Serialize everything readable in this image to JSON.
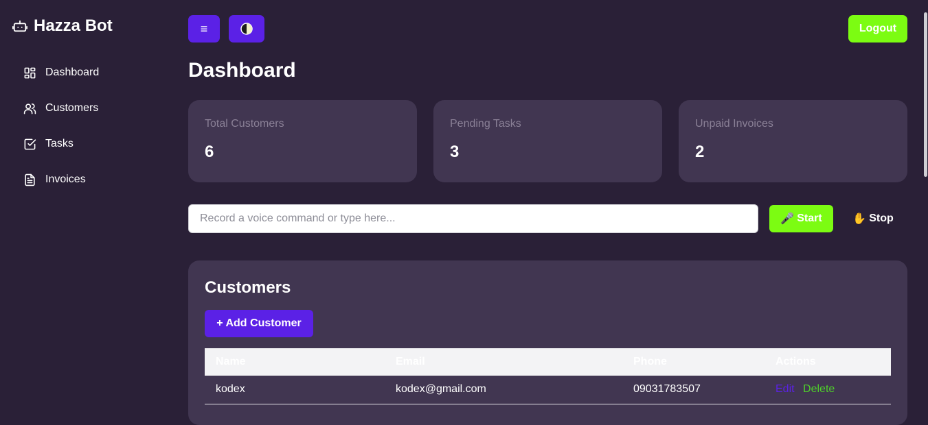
{
  "sidebar": {
    "brand": "Hazza Bot",
    "brand_icon": "robot-icon",
    "items": [
      {
        "label": "Dashboard",
        "icon": "dashboard-icon"
      },
      {
        "label": "Customers",
        "icon": "users-icon"
      },
      {
        "label": "Tasks",
        "icon": "check-square-icon"
      },
      {
        "label": "Invoices",
        "icon": "document-icon"
      }
    ]
  },
  "topbar": {
    "menu_label": "≡",
    "theme_icon": "half-circle-icon",
    "logout_label": "Logout"
  },
  "main": {
    "title": "Dashboard",
    "stats": [
      {
        "label": "Total Customers",
        "value": "6"
      },
      {
        "label": "Pending Tasks",
        "value": "3"
      },
      {
        "label": "Unpaid Invoices",
        "value": "2"
      }
    ],
    "voice": {
      "placeholder": "Record a voice command or type here...",
      "start_label": "Start",
      "start_emoji": "🎤",
      "stop_label": "Stop",
      "stop_emoji": "✋"
    },
    "customers": {
      "title": "Customers",
      "add_label": "+ Add Customer",
      "columns": [
        "Name",
        "Email",
        "Phone",
        "Actions"
      ],
      "rows": [
        {
          "name": "kodex",
          "email": "kodex@gmail.com",
          "phone": "09031783507",
          "edit": "Edit",
          "delete": "Delete"
        }
      ]
    }
  },
  "colors": {
    "background": "#2a2037",
    "card": "#413651",
    "primary": "#5b21e6",
    "accent": "#7cfc12"
  }
}
